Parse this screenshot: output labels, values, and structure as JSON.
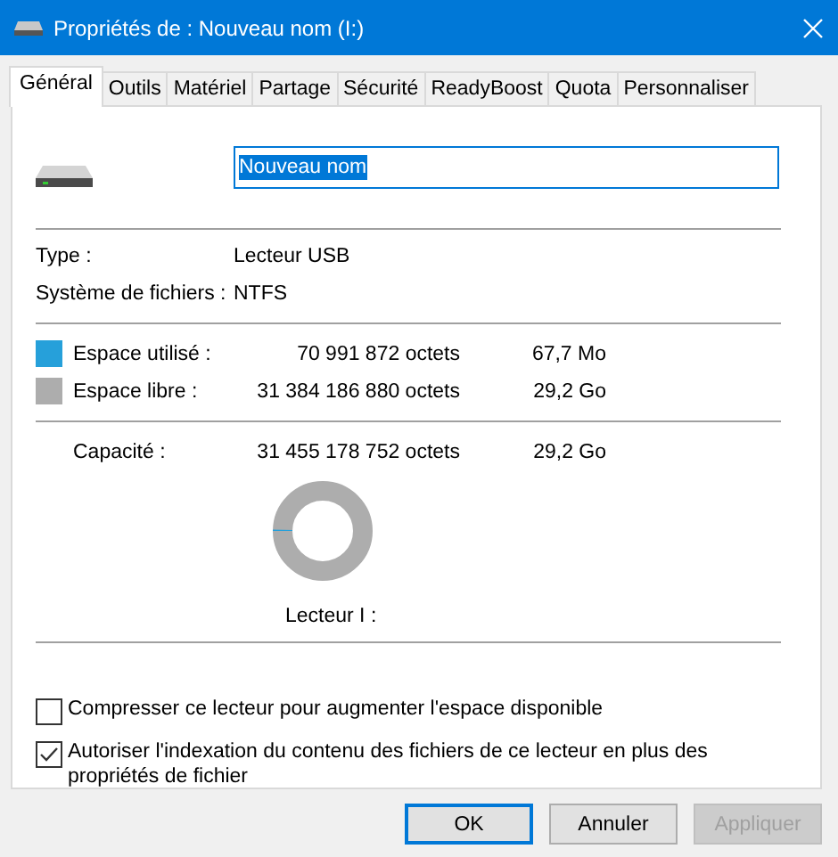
{
  "window": {
    "title": "Propriétés de : Nouveau nom (I:)"
  },
  "tabs": [
    {
      "label": "Général",
      "selected": true
    },
    {
      "label": "Outils",
      "selected": false
    },
    {
      "label": "Matériel",
      "selected": false
    },
    {
      "label": "Partage",
      "selected": false
    },
    {
      "label": "Sécurité",
      "selected": false
    },
    {
      "label": "ReadyBoost",
      "selected": false
    },
    {
      "label": "Quota",
      "selected": false
    },
    {
      "label": "Personnaliser",
      "selected": false
    }
  ],
  "name_field": {
    "value": "Nouveau nom"
  },
  "info": [
    {
      "label": "Type :",
      "value": "Lecteur USB"
    },
    {
      "label": "Système de fichiers :",
      "value": "NTFS"
    }
  ],
  "space": [
    {
      "label": "Espace utilisé :",
      "bytes": "70 991 872 octets",
      "size": "67,7 Mo",
      "color": "#26a0da"
    },
    {
      "label": "Espace libre :",
      "bytes": "31 384 186 880 octets",
      "size": "29,2 Go",
      "color": "#adadad"
    }
  ],
  "capacity": {
    "label": "Capacité :",
    "bytes": "31 455 178 752 octets",
    "size": "29,2 Go"
  },
  "usage": {
    "level": 0.0023
  },
  "drive_label": "Lecteur I :",
  "options": [
    {
      "label": "Compresser ce lecteur pour augmenter l'espace disponible",
      "checked": false
    },
    {
      "label": "Autoriser l'indexation du contenu des fichiers de ce lecteur en plus des propriétés de fichier",
      "checked": true
    }
  ],
  "buttons": [
    {
      "label": "OK",
      "kind": "default",
      "disabled": false
    },
    {
      "label": "Annuler",
      "kind": "normal",
      "disabled": false
    },
    {
      "label": "Appliquer",
      "kind": "normal",
      "disabled": true
    }
  ]
}
